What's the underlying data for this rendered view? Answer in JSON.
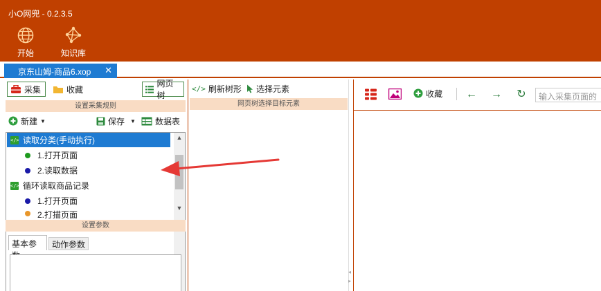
{
  "app": {
    "title": "小O网兜 - 0.2.3.5"
  },
  "ribbon": {
    "start_label": "开始",
    "kb_label": "知识库"
  },
  "tabs": [
    {
      "label": "京东山姆-商品6.xop",
      "close": "✕"
    }
  ],
  "left": {
    "collect_label": "采集",
    "favorites_label": "收藏",
    "webtree_label": "网页树",
    "rules_header": "设置采集规则",
    "new_label": "新建",
    "save_label": "保存",
    "datatable_label": "数据表",
    "tree": [
      {
        "label": "读取分类(手动执行)",
        "kind": "group",
        "selected": true
      },
      {
        "label": "1.打开页面",
        "kind": "step",
        "color": "#1e9a1e"
      },
      {
        "label": "2.读取数据",
        "kind": "step",
        "color": "#1a1aa8"
      },
      {
        "label": "循环读取商品记录",
        "kind": "group",
        "selected": false
      },
      {
        "label": "1.打开页面",
        "kind": "step",
        "color": "#1a1aa8"
      },
      {
        "label": "2.打描页面",
        "kind": "step",
        "color": "#e8962a"
      }
    ],
    "params_header": "设置参数",
    "param_tabs": [
      "基本参数",
      "动作参数"
    ]
  },
  "middle": {
    "refresh_label": "刷新树形",
    "select_label": "选择元素",
    "header": "网页树选择目标元素"
  },
  "right": {
    "favorites_label": "收藏",
    "url_placeholder": "输入采集页面的"
  },
  "colors": {
    "brand": "#c04000",
    "tab_active": "#1e7bd2",
    "section_header": "#f9dcc4",
    "annotation_arrow": "#e53935"
  },
  "icons": {
    "start": "globe-icon",
    "kb": "network-icon",
    "collect": "toolbox-icon",
    "favorites": "folder-icon",
    "webtree": "list-icon",
    "new": "plus-circle-icon",
    "save": "floppy-icon",
    "datatable": "table-icon",
    "refresh": "code-icon",
    "select": "cursor-icon",
    "apps": "grid-icon",
    "image": "image-icon",
    "back": "arrow-left-icon",
    "forward": "arrow-right-icon",
    "reload": "reload-icon"
  }
}
